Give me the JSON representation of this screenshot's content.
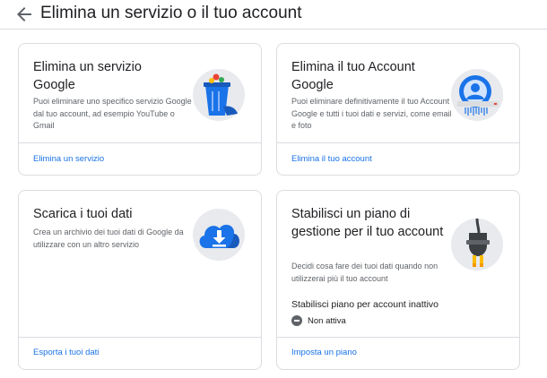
{
  "header": {
    "title": "Elimina un servizio o il tuo account"
  },
  "cards": [
    {
      "title": "Elimina un servizio Google",
      "description": "Puoi eliminare uno specifico servizio Google dal tuo account, ad esempio YouTube o Gmail",
      "action": "Elimina un servizio",
      "illustration": "trash-bin-icon"
    },
    {
      "title": "Elimina il tuo Account Google",
      "description": "Puoi eliminare definitivamente il tuo Account Google e tutti i tuoi dati e servizi, come email e foto",
      "action": "Elimina il tuo account",
      "illustration": "account-shredder-icon"
    },
    {
      "title": "Scarica i tuoi dati",
      "description": "Crea un archivio dei tuoi dati di Google da utilizzare con un altro servizio",
      "action": "Esporta i tuoi dati",
      "illustration": "cloud-download-icon"
    },
    {
      "title": "Stabilisci un piano di gestione per il tuo account",
      "description": "Decidi cosa fare dei tuoi dati quando non utilizzerai più il tuo account",
      "setting_label": "Stabilisci piano per account inattivo",
      "status": "Non attiva",
      "action": "Imposta un piano",
      "illustration": "power-plug-icon"
    }
  ],
  "colors": {
    "link": "#1a73e8",
    "title": "#202124",
    "secondary_text": "#5f6368",
    "border": "#dadce0",
    "illustration_bg": "#e8eaed"
  }
}
